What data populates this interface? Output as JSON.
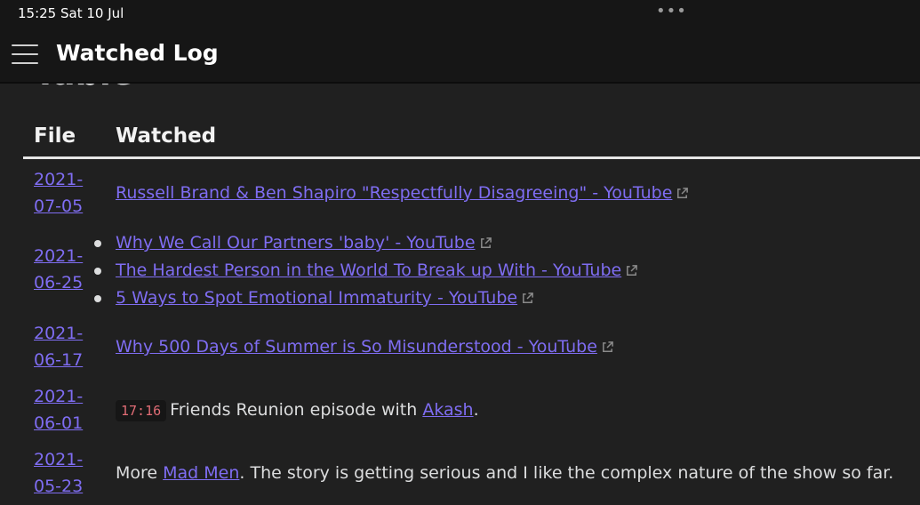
{
  "status": {
    "time_date": "15:25  Sat 10 Jul",
    "dots": "•••"
  },
  "app": {
    "title": "Watched Log"
  },
  "section": {
    "heading": "Table"
  },
  "table": {
    "headers": [
      "File",
      "Watched"
    ],
    "rows": [
      {
        "date_top": "2021-",
        "date_bottom": "07-05",
        "links": [
          "Russell Brand & Ben Shapiro \"Respectfully Disagreeing\" - YouTube"
        ]
      },
      {
        "date_top": "2021-",
        "date_bottom": "06-25",
        "links": [
          "Why We Call Our Partners 'baby' - YouTube",
          "The Hardest Person in the World To Break up With - YouTube",
          "5 Ways to Spot Emotional Immaturity - YouTube"
        ]
      },
      {
        "date_top": "2021-",
        "date_bottom": "06-17",
        "links": [
          "Why 500 Days of Summer is So Misunderstood - YouTube"
        ]
      },
      {
        "date_top": "2021-",
        "date_bottom": "06-01",
        "time_code": "17:16",
        "text_before": "Friends Reunion episode with ",
        "link": "Akash",
        "text_after": "."
      },
      {
        "date_top": "2021-",
        "date_bottom": "05-23",
        "text_before": "More ",
        "link": "Mad Men",
        "text_after": ". The story is getting serious and I like the complex nature of the show so far."
      }
    ]
  },
  "colors": {
    "accent": "#7f6df2",
    "background": "#202020",
    "code_text": "#e06c75"
  },
  "icons": {
    "menu": "hamburger-icon",
    "external_link": "external-link-icon"
  }
}
